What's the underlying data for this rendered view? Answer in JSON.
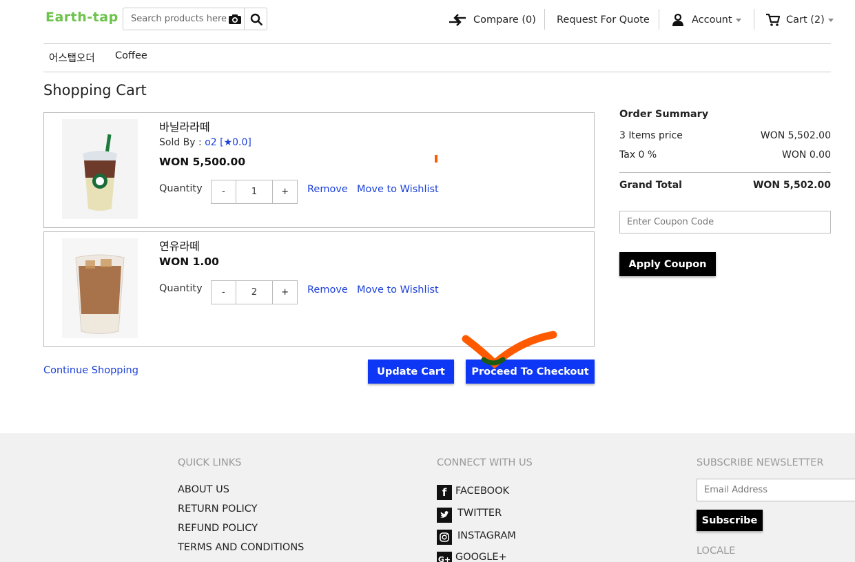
{
  "header": {
    "logo": "Earth-tap",
    "search_placeholder": "Search products here",
    "compare_label": "Compare (0)",
    "quote_label": "Request For Quote",
    "account_label": "Account",
    "cart_label": "Cart (2)"
  },
  "categories": [
    "어스탭오더",
    "Coffee"
  ],
  "page_title": "Shopping Cart",
  "items": [
    {
      "name": "바닐라라떼",
      "sold_by_label": "Sold By :",
      "seller": "o2",
      "rating": "[★0.0]",
      "price": "WON 5,500.00",
      "quantity_label": "Quantity",
      "quantity": "1",
      "minus": "-",
      "plus": "+",
      "remove": "Remove",
      "wishlist": "Move to Wishlist"
    },
    {
      "name": "연유라떼",
      "price": "WON 1.00",
      "quantity_label": "Quantity",
      "quantity": "2",
      "minus": "-",
      "plus": "+",
      "remove": "Remove",
      "wishlist": "Move to Wishlist"
    }
  ],
  "actions": {
    "continue": "Continue Shopping",
    "update": "Update Cart",
    "checkout": "Proceed To Checkout"
  },
  "summary": {
    "title": "Order Summary",
    "items_label": "3 Items price",
    "items_value": "WON 5,502.00",
    "tax_label": "Tax 0 %",
    "tax_value": "WON 0.00",
    "total_label": "Grand Total",
    "total_value": "WON 5,502.00",
    "coupon_placeholder": "Enter Coupon Code",
    "apply_label": "Apply Coupon"
  },
  "footer": {
    "quick_links_title": "QUICK LINKS",
    "quick_links": [
      "ABOUT US",
      "RETURN POLICY",
      "REFUND POLICY",
      "TERMS AND CONDITIONS"
    ],
    "connect_title": "CONNECT WITH US",
    "social": [
      "FACEBOOK",
      "TWITTER",
      "INSTAGRAM",
      "GOOGLE+"
    ],
    "subscribe_title": "SUBSCRIBE NEWSLETTER",
    "email_placeholder": "Email Address",
    "subscribe_label": "Subscribe",
    "locale_title": "LOCALE"
  },
  "colors": {
    "brand_green": "#6cc24a",
    "link_blue": "#1a3fd9",
    "button_blue": "#0d36f5",
    "annotation_orange": "#ff5a00"
  }
}
